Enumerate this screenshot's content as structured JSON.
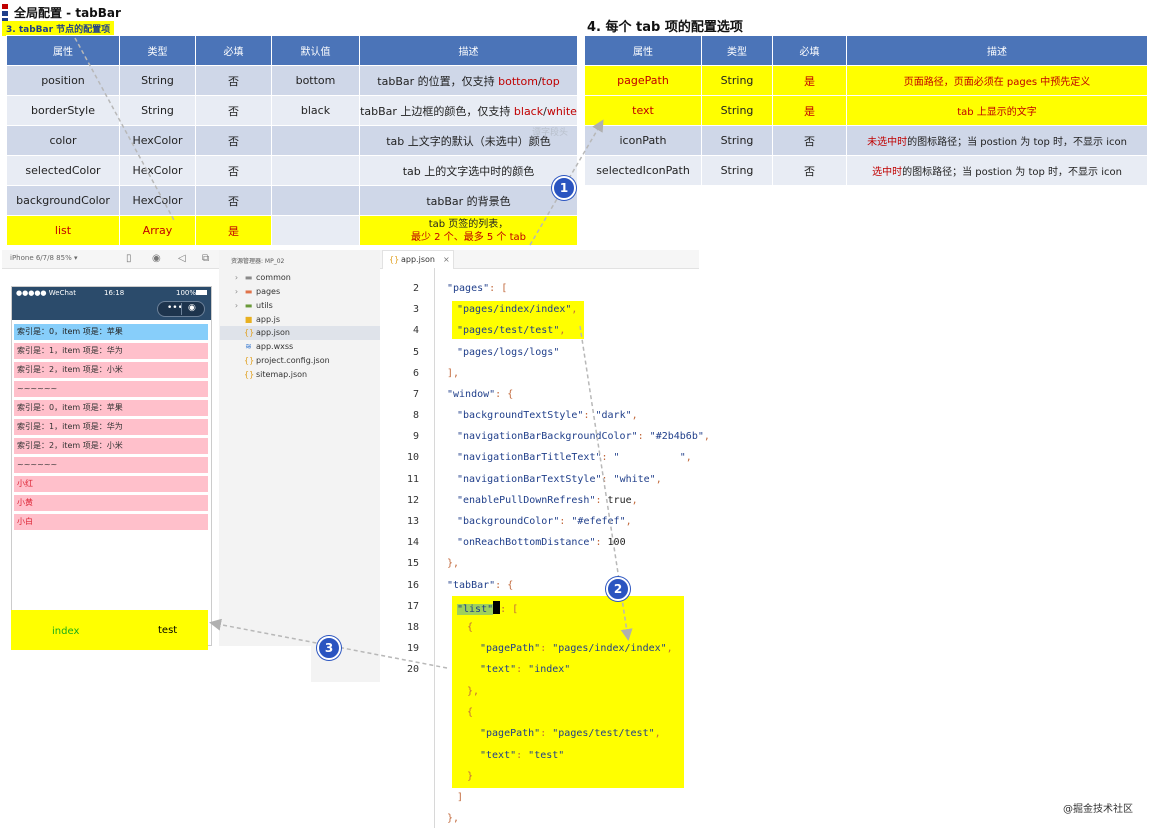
{
  "heading": {
    "title": "全局配置 - tabBar",
    "subtitle": "3. tabBar 节点的配置项",
    "section4": "4. 每个 tab 项的配置选项"
  },
  "table_left": {
    "headers": [
      "属性",
      "类型",
      "必填",
      "默认值",
      "描述"
    ],
    "rows": [
      {
        "attr": "position",
        "type": "String",
        "req": "否",
        "def": "bottom",
        "desc_pre": "tabBar 的位置，仅支持 ",
        "desc_a": "bottom",
        "desc_mid": "/",
        "desc_b": "top"
      },
      {
        "attr": "borderStyle",
        "type": "String",
        "req": "否",
        "def": "black",
        "desc_pre": "tabBar 上边框的颜色，仅支持 ",
        "desc_a": "black",
        "desc_mid": "/",
        "desc_b": "white"
      },
      {
        "attr": "color",
        "type": "HexColor",
        "req": "否",
        "def": "",
        "desc": "tab 上文字的默认（未选中）颜色"
      },
      {
        "attr": "selectedColor",
        "type": "HexColor",
        "req": "否",
        "def": "",
        "desc": "tab 上的文字选中时的颜色"
      },
      {
        "attr": "backgroundColor",
        "type": "HexColor",
        "req": "否",
        "def": "",
        "desc": "tabBar 的背景色"
      },
      {
        "attr": "list",
        "type": "Array",
        "req": "是",
        "def": "",
        "desc_l1": "tab 页签的列表，",
        "desc_l2": "最少 2 个、最多 5 个 tab"
      }
    ]
  },
  "table_right": {
    "headers": [
      "属性",
      "类型",
      "必填",
      "描述"
    ],
    "rows": [
      {
        "attr": "pagePath",
        "type": "String",
        "req": "是",
        "desc": "页面路径，页面必须在 pages 中预先定义"
      },
      {
        "attr": "text",
        "type": "String",
        "req": "是",
        "desc": "tab 上显示的文字"
      },
      {
        "attr": "iconPath",
        "type": "String",
        "req": "否",
        "desc_red": "未选中时",
        "desc": "的图标路径；当 postion 为 top 时，不显示 icon"
      },
      {
        "attr": "selectedIconPath",
        "type": "String",
        "req": "否",
        "desc_red": "选中时",
        "desc": "的图标路径；当 postion 为 top 时，不显示 icon"
      }
    ]
  },
  "ghost_text": "谭字段头",
  "toolbar": {
    "device": "iPhone 6/7/8 85% ▾"
  },
  "phone": {
    "status_left": "●●●●● WeChat",
    "status_time": "16:18",
    "status_right": "100%",
    "capsule_dots": "•••",
    "capsule_target": "◉",
    "rows": [
      "索引是：0，item 项是：苹果",
      "索引是：1，item 项是：华为",
      "索引是：2，item 项是：小米",
      "~~~~~~",
      "索引是：0，item 项是：苹果",
      "索引是：1，item 项是：华为",
      "索引是：2，item 项是：小米",
      "~~~~~~",
      "小红",
      "小黄",
      "小白"
    ],
    "tab_index": "index",
    "tab_test": "test"
  },
  "explorer": {
    "header": "资源管理器: MP_02",
    "items": [
      {
        "label": "common",
        "icon": "folder"
      },
      {
        "label": "pages",
        "icon": "folder"
      },
      {
        "label": "utils",
        "icon": "folder"
      },
      {
        "label": "app.js",
        "icon": "js"
      },
      {
        "label": "app.json",
        "icon": "json"
      },
      {
        "label": "app.wxss",
        "icon": "wxss"
      },
      {
        "label": "project.config.json",
        "icon": "json"
      },
      {
        "label": "sitemap.json",
        "icon": "json"
      }
    ]
  },
  "editor": {
    "tab": "app.json",
    "lines": [
      2,
      3,
      4,
      5,
      6,
      7,
      8,
      9,
      10,
      11,
      12,
      13,
      14,
      15,
      16,
      17,
      18,
      19,
      20
    ]
  },
  "badges": [
    "1",
    "2",
    "3"
  ],
  "watermark": "@掘金技术社区"
}
